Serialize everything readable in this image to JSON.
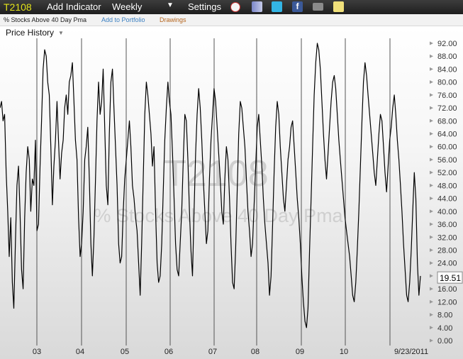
{
  "toolbar": {
    "symbol": "T2108",
    "add_indicator": "Add Indicator",
    "interval": "Weekly",
    "settings": "Settings",
    "icons": [
      "alarm-clock-icon",
      "database-icon",
      "twitter-icon",
      "facebook-icon",
      "camera-icon",
      "notepad-icon"
    ]
  },
  "subbar": {
    "series_name": "% Stocks Above 40 Day Pma",
    "add_to_portfolio": "Add to Portfolio",
    "drawings": "Drawings"
  },
  "panel": {
    "title": "Price History"
  },
  "colors": {
    "line": "#000000",
    "symbol": "#e3e31a",
    "link": "#3a7fc1",
    "drawings": "#b5651d",
    "divider": "#555555"
  },
  "chart_data": {
    "type": "line",
    "watermark_symbol": "T2108",
    "watermark_name": "% Stocks Above 40 Day Pma",
    "ylim": [
      0,
      94
    ],
    "y_ticks": [
      "92.00",
      "88.00",
      "84.00",
      "80.00",
      "76.00",
      "72.00",
      "68.00",
      "64.00",
      "60.00",
      "56.00",
      "52.00",
      "48.00",
      "44.00",
      "40.00",
      "36.00",
      "32.00",
      "28.00",
      "24.00",
      "20.00",
      "16.00",
      "12.00",
      "8.00",
      "4.00",
      "0.00"
    ],
    "x_labels": [
      "03",
      "04",
      "05",
      "06",
      "07",
      "08",
      "09",
      "10",
      "9/23/2011"
    ],
    "last_value": "19.51",
    "series": [
      {
        "values": [
          72,
          74,
          68,
          70,
          52,
          40,
          26,
          38,
          18,
          10,
          30,
          48,
          54,
          40,
          22,
          16,
          38,
          52,
          60,
          56,
          40,
          50,
          48,
          62,
          34,
          36,
          54,
          68,
          84,
          90,
          88,
          80,
          76,
          60,
          42,
          54,
          62,
          74,
          62,
          50,
          58,
          62,
          72,
          76,
          70,
          80,
          82,
          86,
          74,
          62,
          56,
          38,
          26,
          30,
          40,
          56,
          60,
          66,
          50,
          30,
          20,
          32,
          50,
          68,
          80,
          70,
          74,
          84,
          66,
          48,
          42,
          64,
          80,
          84,
          72,
          60,
          48,
          30,
          24,
          26,
          40,
          50,
          56,
          62,
          68,
          60,
          48,
          44,
          38,
          34,
          24,
          14,
          30,
          50,
          70,
          80,
          76,
          70,
          64,
          54,
          60,
          40,
          24,
          18,
          20,
          30,
          46,
          62,
          72,
          80,
          74,
          70,
          58,
          44,
          30,
          22,
          20,
          30,
          40,
          56,
          70,
          68,
          56,
          40,
          28,
          20,
          40,
          58,
          70,
          78,
          72,
          62,
          50,
          40,
          30,
          34,
          50,
          62,
          70,
          78,
          74,
          66,
          58,
          50,
          40,
          36,
          50,
          60,
          56,
          44,
          30,
          18,
          16,
          28,
          46,
          64,
          74,
          72,
          66,
          60,
          50,
          40,
          34,
          26,
          30,
          42,
          54,
          66,
          70,
          62,
          54,
          44,
          36,
          30,
          24,
          14,
          20,
          36,
          52,
          66,
          74,
          70,
          60,
          52,
          44,
          40,
          48,
          56,
          60,
          66,
          68,
          60,
          52,
          44,
          38,
          30,
          20,
          12,
          6,
          4,
          10,
          28,
          44,
          60,
          76,
          86,
          92,
          90,
          84,
          74,
          64,
          56,
          50,
          58,
          66,
          74,
          80,
          82,
          78,
          70,
          62,
          56,
          50,
          44,
          38,
          34,
          30,
          26,
          20,
          14,
          12,
          18,
          28,
          40,
          54,
          68,
          80,
          86,
          82,
          76,
          70,
          64,
          58,
          52,
          48,
          56,
          64,
          70,
          68,
          60,
          52,
          46,
          54,
          62,
          66,
          72,
          76,
          70,
          62,
          56,
          48,
          40,
          30,
          22,
          14,
          12,
          18,
          28,
          40,
          52,
          44,
          24,
          14,
          20
        ]
      }
    ]
  }
}
